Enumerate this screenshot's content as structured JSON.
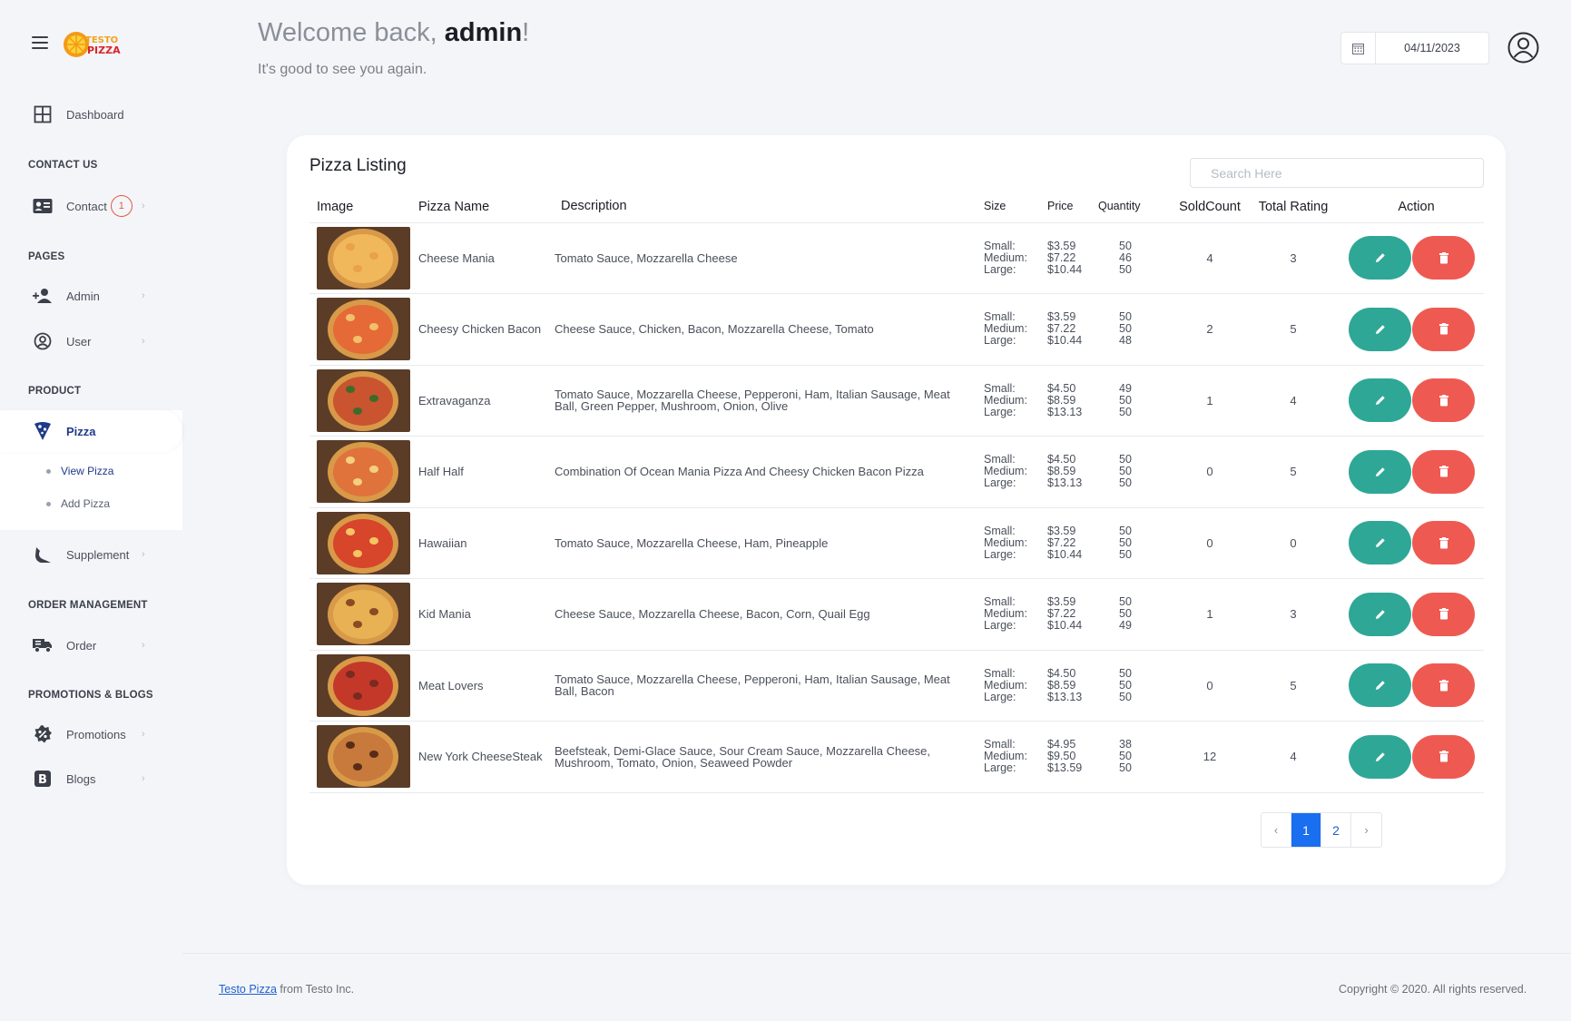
{
  "header": {
    "welcome_prefix": "Welcome back, ",
    "username": "admin",
    "welcome_suffix": "!",
    "subtitle": "It's good to see you again.",
    "date": "04/11/2023"
  },
  "logo": {
    "line1": "TESTO",
    "line2": "PIZZA"
  },
  "sidebar": {
    "dashboard": "Dashboard",
    "sections": {
      "contact": "CONTACT US",
      "pages": "PAGES",
      "product": "PRODUCT",
      "order": "ORDER MANAGEMENT",
      "promo": "PROMOTIONS & BLOGS"
    },
    "contact": "Contact",
    "contact_badge": "1",
    "admin": "Admin",
    "user": "User",
    "pizza": "Pizza",
    "view_pizza": "View Pizza",
    "add_pizza": "Add Pizza",
    "supplement": "Supplement",
    "order": "Order",
    "promotions": "Promotions",
    "blogs": "Blogs"
  },
  "listing": {
    "title": "Pizza Listing",
    "search_placeholder": "Search Here",
    "columns": [
      "Image",
      "Pizza Name",
      "Description",
      "Size",
      "Price",
      "Quantity",
      "SoldCount",
      "Total Rating",
      "Action"
    ],
    "size_labels": [
      "Small:",
      "Medium:",
      "Large:"
    ],
    "rows": [
      {
        "name": "Cheese Mania",
        "description": "Tomato Sauce, Mozzarella Cheese",
        "prices": [
          "$3.59",
          "$7.22",
          "$10.44"
        ],
        "qty": [
          "50",
          "46",
          "50"
        ],
        "sold": "4",
        "rating": "3"
      },
      {
        "name": "Cheesy Chicken Bacon",
        "description": "Cheese Sauce, Chicken, Bacon, Mozzarella Cheese, Tomato",
        "prices": [
          "$3.59",
          "$7.22",
          "$10.44"
        ],
        "qty": [
          "50",
          "50",
          "48"
        ],
        "sold": "2",
        "rating": "5"
      },
      {
        "name": "Extravaganza",
        "description": "Tomato Sauce, Mozzarella Cheese, Pepperoni, Ham, Italian Sausage, Meat Ball, Green Pepper, Mushroom, Onion, Olive",
        "prices": [
          "$4.50",
          "$8.59",
          "$13.13"
        ],
        "qty": [
          "49",
          "50",
          "50"
        ],
        "sold": "1",
        "rating": "4"
      },
      {
        "name": "Half Half",
        "description": "Combination Of Ocean Mania Pizza And Cheesy Chicken Bacon Pizza",
        "prices": [
          "$4.50",
          "$8.59",
          "$13.13"
        ],
        "qty": [
          "50",
          "50",
          "50"
        ],
        "sold": "0",
        "rating": "5"
      },
      {
        "name": "Hawaiian",
        "description": "Tomato Sauce, Mozzarella Cheese, Ham, Pineapple",
        "prices": [
          "$3.59",
          "$7.22",
          "$10.44"
        ],
        "qty": [
          "50",
          "50",
          "50"
        ],
        "sold": "0",
        "rating": "0"
      },
      {
        "name": "Kid Mania",
        "description": "Cheese Sauce, Mozzarella Cheese, Bacon, Corn, Quail Egg",
        "prices": [
          "$3.59",
          "$7.22",
          "$10.44"
        ],
        "qty": [
          "50",
          "50",
          "49"
        ],
        "sold": "1",
        "rating": "3"
      },
      {
        "name": "Meat Lovers",
        "description": "Tomato Sauce, Mozzarella Cheese, Pepperoni, Ham, Italian Sausage, Meat Ball, Bacon",
        "prices": [
          "$4.50",
          "$8.59",
          "$13.13"
        ],
        "qty": [
          "50",
          "50",
          "50"
        ],
        "sold": "0",
        "rating": "5"
      },
      {
        "name": "New York CheeseSteak",
        "description": "Beefsteak, Demi-Glace Sauce, Sour Cream Sauce, Mozzarella Cheese, Mushroom, Tomato, Onion, Seaweed Powder",
        "prices": [
          "$4.95",
          "$9.50",
          "$13.59"
        ],
        "qty": [
          "38",
          "50",
          "50"
        ],
        "sold": "12",
        "rating": "4"
      }
    ]
  },
  "pagination": {
    "prev": "‹",
    "pages": [
      "1",
      "2"
    ],
    "current": "1",
    "next": "›"
  },
  "footer": {
    "brand_link": "Testo Pizza",
    "brand_suffix": " from Testo Inc.",
    "copyright": "Copyright © 2020. All rights reserved."
  },
  "colors": {
    "edit": "#2fa796",
    "delete": "#ee5a52",
    "active_nav": "#1f3a8a",
    "page_current": "#1a6ef0"
  },
  "icons": {
    "menu": "hamburger-icon",
    "dashboard": "grid-icon",
    "contact": "id-card-icon",
    "admin": "user-plus-icon",
    "user": "user-circle-icon",
    "pizza": "pizza-slice-icon",
    "supplement": "drumstick-icon",
    "order": "truck-icon",
    "promotions": "badge-percent-icon",
    "blogs": "blog-b-icon",
    "calendar": "calendar-icon",
    "edit": "pencil-icon",
    "delete": "trash-icon"
  }
}
